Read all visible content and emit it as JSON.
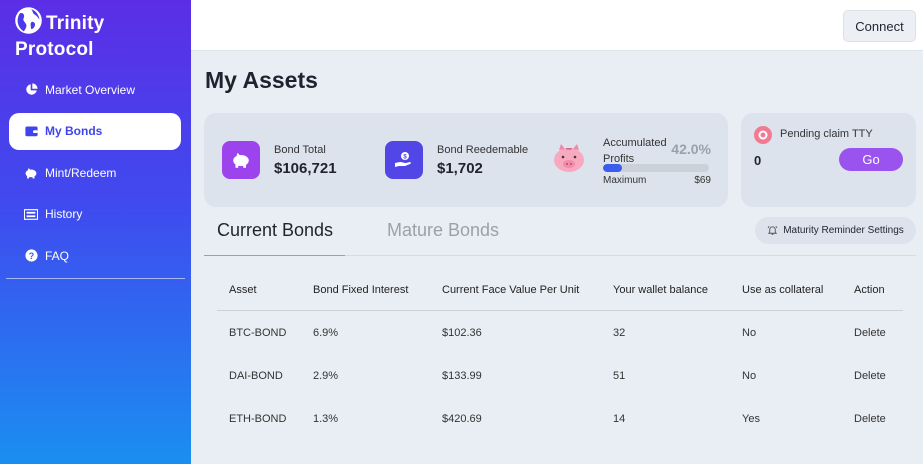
{
  "brand": {
    "line1": "Trinity",
    "line2": "Protocol"
  },
  "sidebar": {
    "items": [
      {
        "label": "Market Overview",
        "icon": "pie-chart-icon"
      },
      {
        "label": "My Bonds",
        "icon": "wallet-icon",
        "active": true
      },
      {
        "label": "Mint/Redeem",
        "icon": "piggy-bank-icon"
      },
      {
        "label": "History",
        "icon": "ledger-icon"
      },
      {
        "label": "FAQ",
        "icon": "question-icon"
      }
    ]
  },
  "header": {
    "connect_label": "Connect"
  },
  "page": {
    "title": "My Assets"
  },
  "stats": {
    "bond_total_label": "Bond Total",
    "bond_total_value": "$106,721",
    "bond_redeemable_label": "Bond Reedemable",
    "bond_redeemable_value": "$1,702",
    "profits_label": "Accumulated Profits",
    "profits_pct": "42.0%",
    "profits_fraction": 0.18,
    "maximum_label": "Maximum",
    "maximum_value": "$69"
  },
  "pending": {
    "label": "Pending claim TTY",
    "value": "0",
    "go_label": "Go"
  },
  "tabs": {
    "current": "Current Bonds",
    "mature": "Mature Bonds",
    "reminder_label": "Maturity Reminder Settings"
  },
  "table": {
    "headers": [
      "Asset",
      "Bond Fixed Interest",
      "Current Face Value Per Unit",
      "Your wallet balance",
      "Use as collateral",
      "Action"
    ],
    "rows": [
      [
        "BTC-BOND",
        "6.9%",
        "$102.36",
        "32",
        "No",
        "Delete"
      ],
      [
        "DAI-BOND",
        "2.9%",
        "$133.99",
        "51",
        "No",
        "Delete"
      ],
      [
        "ETH-BOND",
        "1.3%",
        "$420.69",
        "14",
        "Yes",
        "Delete"
      ]
    ]
  },
  "colors": {
    "accent": "#3e45ee",
    "go_button": "#9a53ee",
    "sidebar_top": "#5b2ee6",
    "sidebar_bottom": "#1a8ff0"
  }
}
